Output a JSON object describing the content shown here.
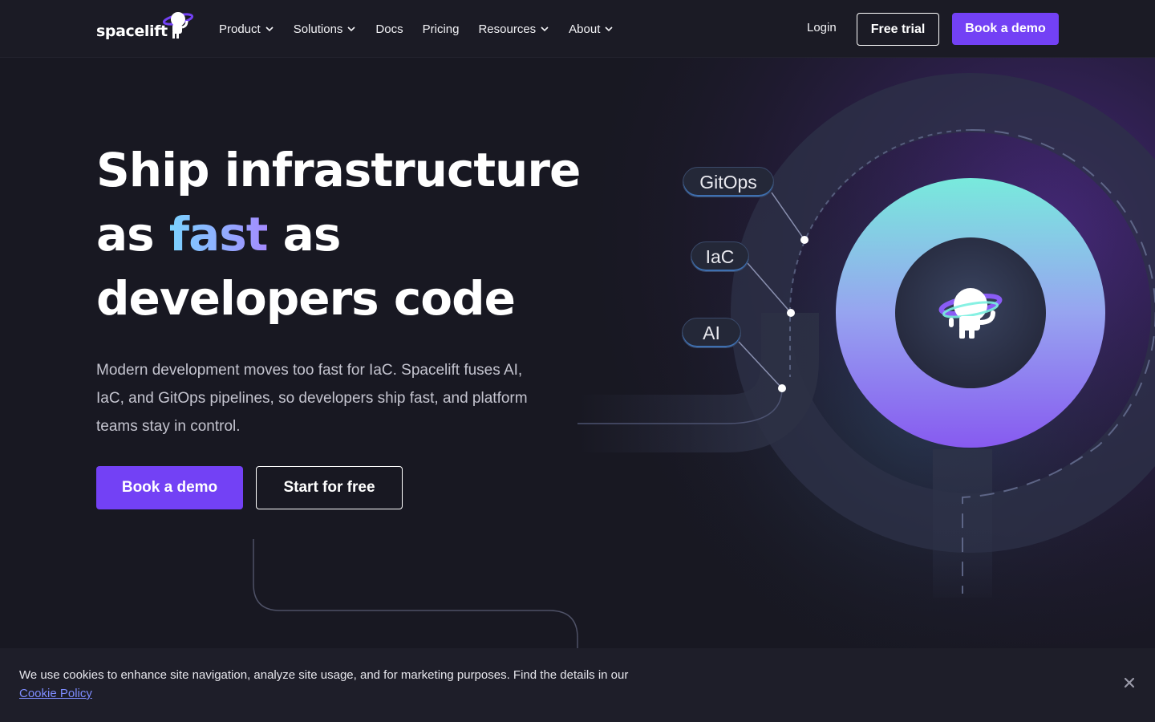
{
  "brand": {
    "name": "spacelift"
  },
  "nav": {
    "items": [
      {
        "label": "Product",
        "dropdown": true
      },
      {
        "label": "Solutions",
        "dropdown": true
      },
      {
        "label": "Docs",
        "dropdown": false
      },
      {
        "label": "Pricing",
        "dropdown": false
      },
      {
        "label": "Resources",
        "dropdown": true
      },
      {
        "label": "About",
        "dropdown": true
      }
    ],
    "login": "Login",
    "free_trial": "Free trial",
    "book_demo": "Book a demo"
  },
  "hero": {
    "title_line1": "Ship infrastructure",
    "title_as1": "as ",
    "title_fast": "fast",
    "title_as2": " as",
    "title_line3": "developers code",
    "subtitle": "Modern development moves too fast for IaC. Spacelift fuses AI, IaC, and GitOps pipelines, so developers ship fast, and platform teams stay in control.",
    "cta_primary": "Book a demo",
    "cta_secondary": "Start for free"
  },
  "illustration": {
    "tags": [
      "GitOps",
      "IaC",
      "AI"
    ]
  },
  "cookie": {
    "text": "We use cookies to enhance site navigation, analyze site usage, and for marketing purposes. Find the details in our ",
    "link": "Cookie Policy"
  },
  "colors": {
    "background": "#181822",
    "accent": "#7341f5",
    "ring_top": "#7af0e0",
    "ring_bottom": "#8a5cf5"
  }
}
